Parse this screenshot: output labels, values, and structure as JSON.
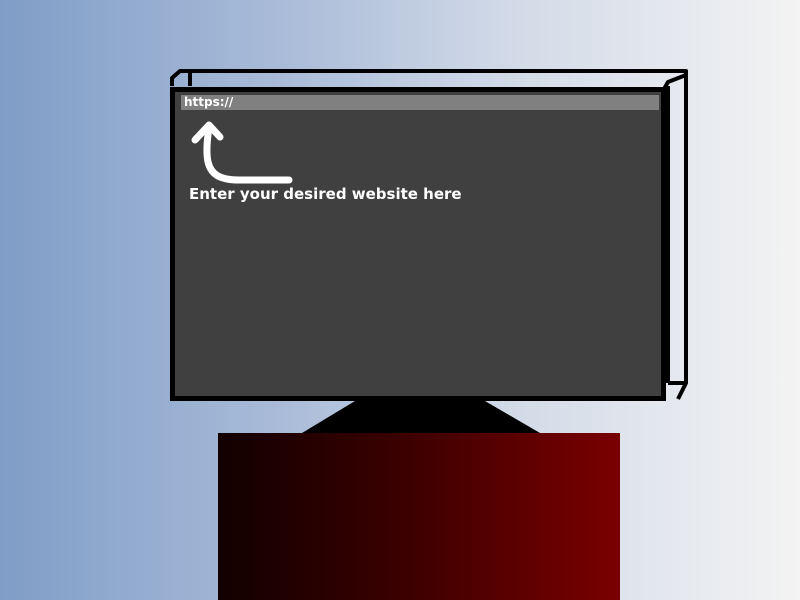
{
  "browser": {
    "url_value": "https://"
  },
  "hint": {
    "text": "Enter your desired website here"
  },
  "colors": {
    "screen": "#404040",
    "url_bar": "#808080",
    "text": "#ffffff",
    "pedestal_dark": "#120000",
    "pedestal_light": "#7a0000"
  },
  "icons": {
    "hint_arrow": "curved-arrow-up-icon"
  }
}
